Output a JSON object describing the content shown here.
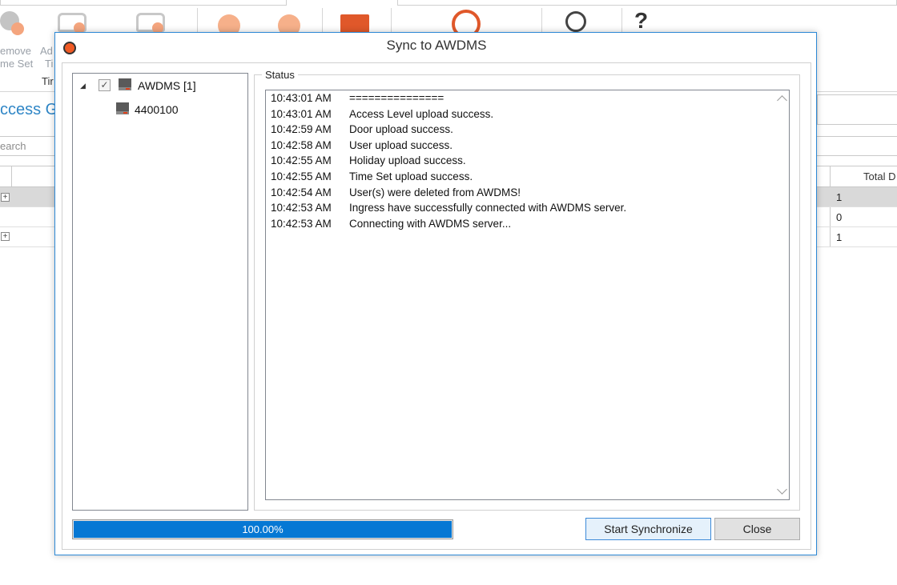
{
  "background": {
    "toolbar": {
      "remove_time_set_label_line1": "emove",
      "remove_time_set_label_line2": "me Set",
      "add_label_line1": "Ad",
      "add_label_line2": "Ti",
      "group_label": "Tir",
      "help_glyph": "?"
    },
    "section_title": "ccess G",
    "search_placeholder": "earch",
    "grid": {
      "column_header": "Total D",
      "rows": [
        {
          "expand": "+",
          "value": "1"
        },
        {
          "expand": "",
          "value": "0"
        },
        {
          "expand": "+",
          "value": "1"
        }
      ]
    },
    "colors": {
      "accent": "#2f86c6",
      "icon_red": "#f05a24"
    }
  },
  "dialog": {
    "title": "Sync to AWDMS",
    "tree": {
      "root_label": "AWDMS [1]",
      "root_checked": true,
      "child_label": "4400100"
    },
    "status": {
      "legend": "Status",
      "lines": [
        {
          "time": "10:43:01 AM",
          "message": "==============="
        },
        {
          "time": "10:43:01 AM",
          "message": "Access Level upload success."
        },
        {
          "time": "10:42:59 AM",
          "message": "Door upload success."
        },
        {
          "time": "10:42:58 AM",
          "message": "User upload success."
        },
        {
          "time": "10:42:55 AM",
          "message": "Holiday upload success."
        },
        {
          "time": "10:42:55 AM",
          "message": "Time Set upload success."
        },
        {
          "time": "10:42:54 AM",
          "message": "User(s) were deleted from AWDMS!"
        },
        {
          "time": "10:42:53 AM",
          "message": "Ingress have successfully connected with AWDMS server."
        },
        {
          "time": "10:42:53 AM",
          "message": "Connecting with AWDMS server..."
        }
      ]
    },
    "progress": {
      "fraction": 1.0,
      "text": "100.00%"
    },
    "buttons": {
      "start": "Start Synchronize",
      "close": "Close"
    },
    "colors": {
      "border": "#2d89d6",
      "progress": "#0678d4"
    }
  }
}
